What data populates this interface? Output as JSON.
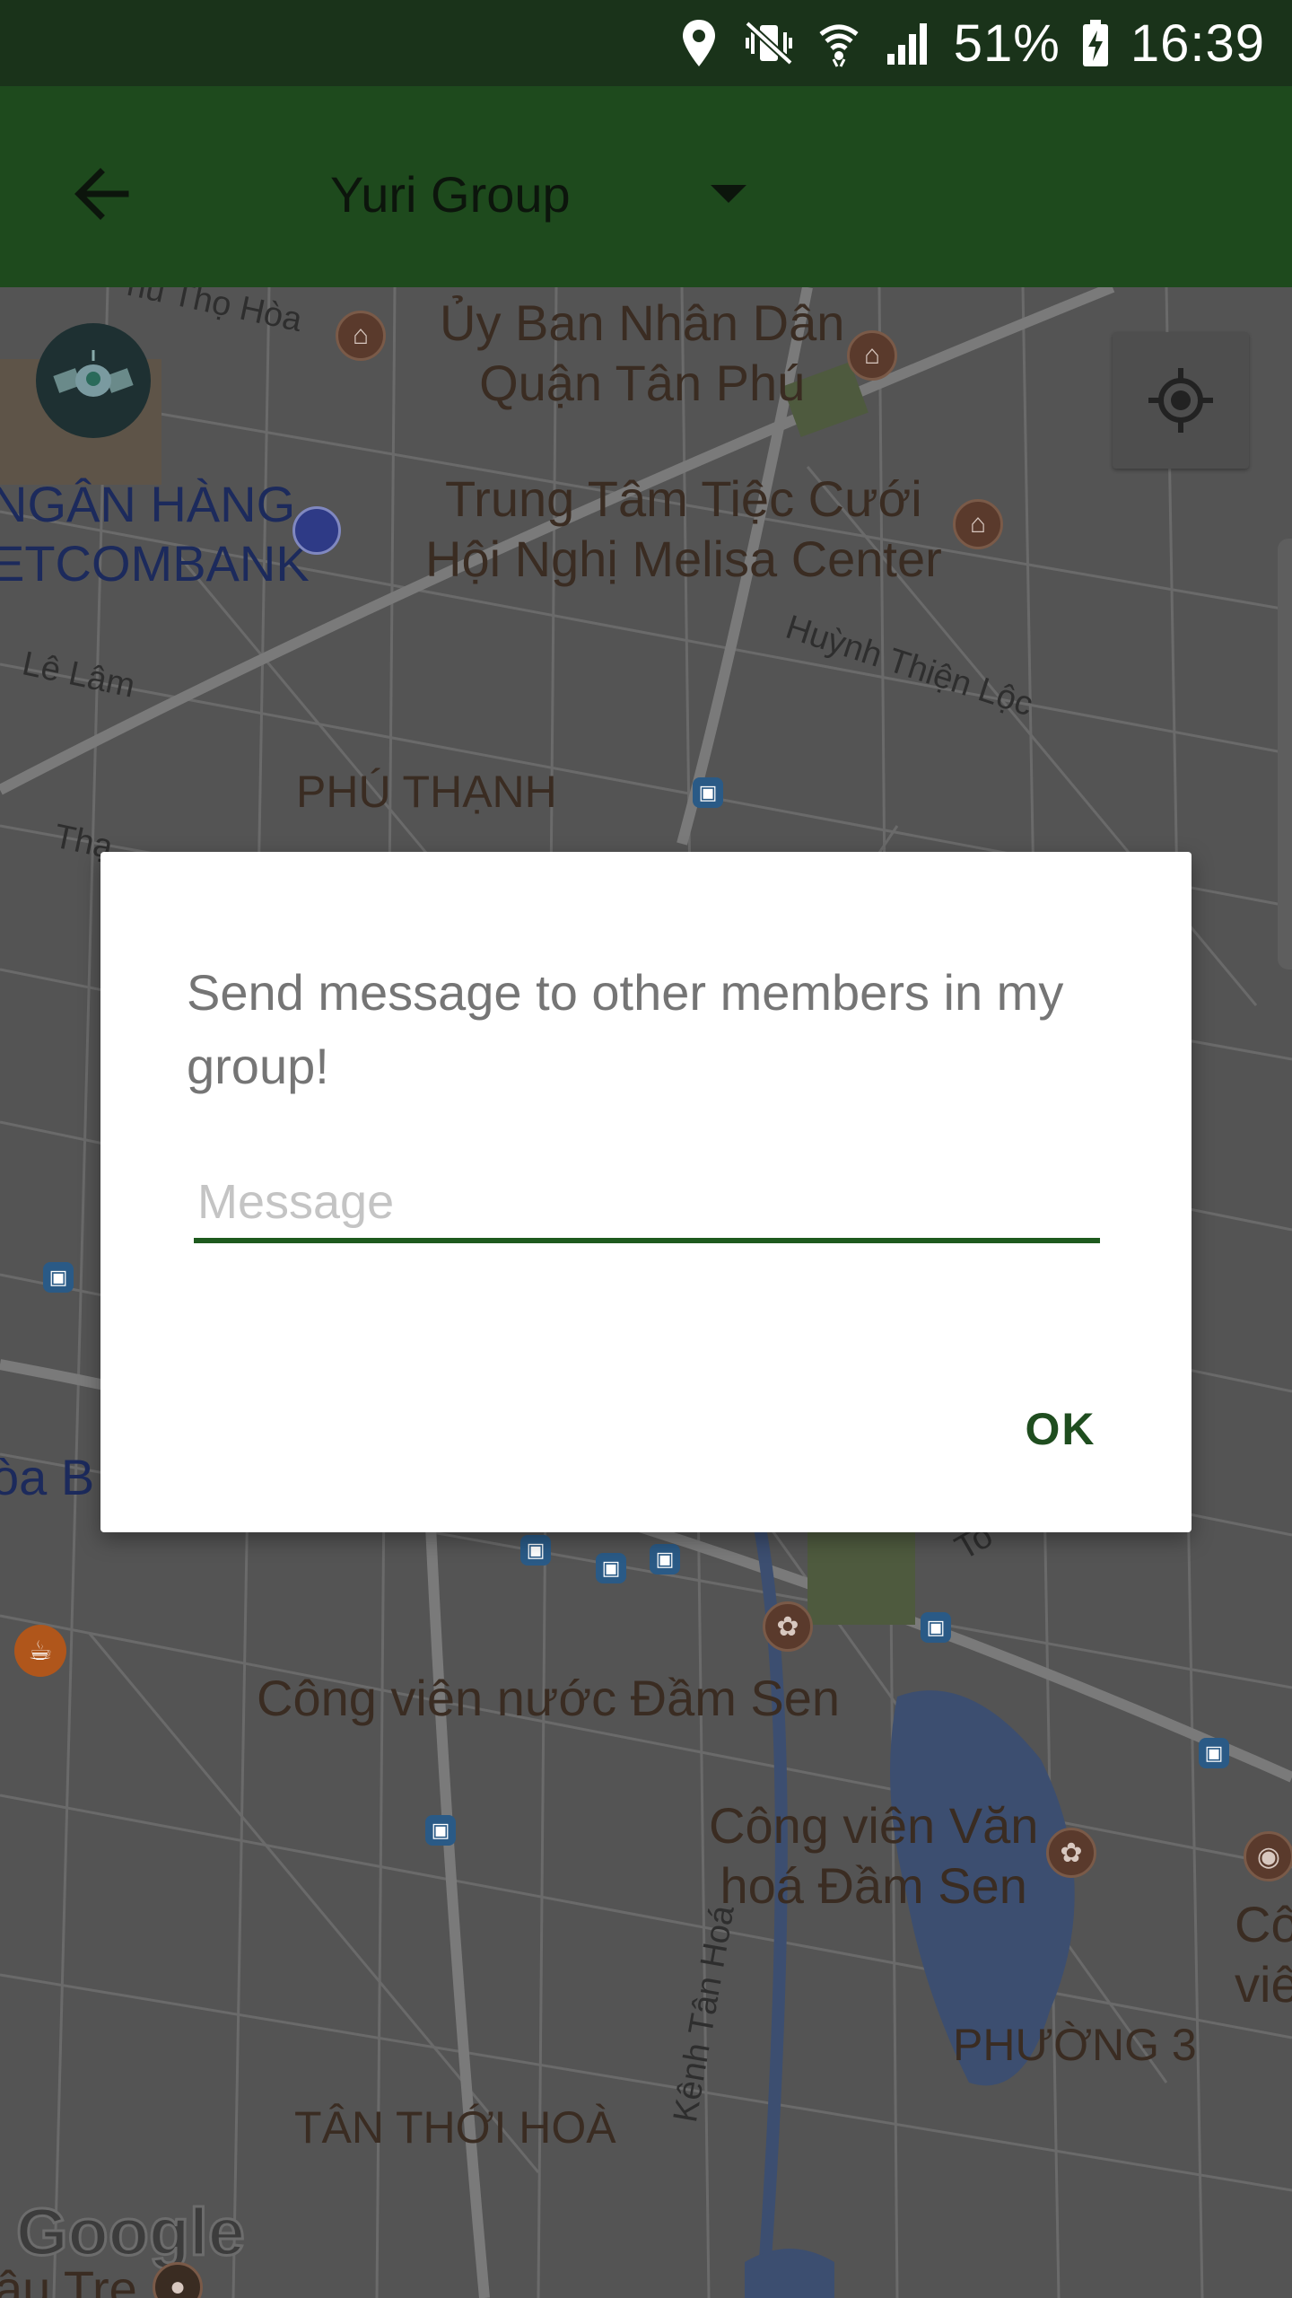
{
  "status_bar": {
    "battery": "51%",
    "time": "16:39",
    "icons": [
      "location-icon",
      "vibrate-mute-icon",
      "wifi-icon",
      "signal-icon",
      "battery-charging-icon"
    ]
  },
  "app_bar": {
    "back_icon": "arrow-back-icon",
    "group_name": "Yuri Group",
    "dropdown_icon": "caret-down-icon",
    "bg_color": "#1e4a1d"
  },
  "map": {
    "labels": {
      "tho_hoa": "nu Thọ Hòa",
      "uy_ban": "Ủy Ban Nhân Dân\nQuận Tân Phú",
      "ngan_hang_1": "NGÂN HÀNG",
      "ngan_hang_2": "ETCOMBANK",
      "trung_tam": "Trung Tâm Tiệc Cưới\nHội Nghị Melisa Center",
      "huynh": "Huỳnh Thiện Lộc",
      "le_lam": "Lê Lâm",
      "phu_thanh": "PHÚ THẠNH",
      "tha": "Thạ",
      "hoa_b": "òa B",
      "cong_vien_nuoc": "Công viên nước Đầm Sen",
      "cong_vien_van_hoa": "Công viên Văn\nhoá Đầm Sen",
      "co_vie": "Cô\nviê",
      "phuong_3": "PHƯỜNG 3",
      "tan_thoi_hoa": "TÂN THỚI HOÀ",
      "kenh_tan_hoa": "Kênh Tân Hoá",
      "au_tre": "âu Tre",
      "to": "To"
    },
    "google_logo": "Google",
    "satellite_icon": "satellite-icon",
    "my_location_icon": "my-location-icon"
  },
  "dialog": {
    "message": "Send message to other members in my group!",
    "input_value": "",
    "input_placeholder": "Message",
    "ok_label": "OK",
    "accent_color": "#1e5a1e"
  }
}
